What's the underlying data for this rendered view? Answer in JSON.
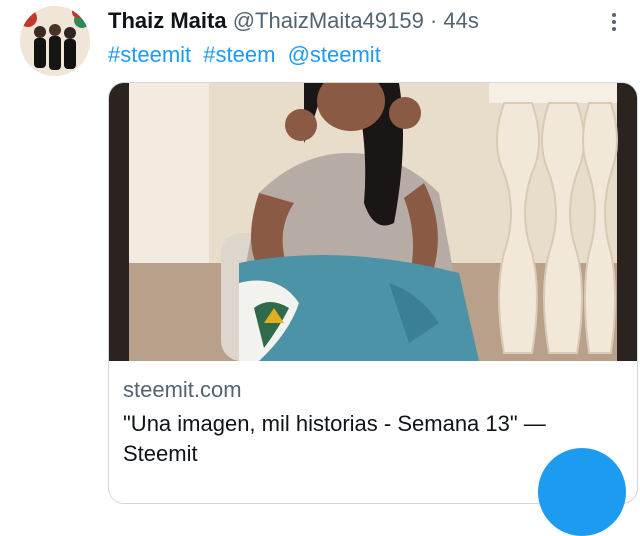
{
  "tweet": {
    "name": "Thaiz Maita",
    "handle": "@ThaizMaita49159",
    "separator": "·",
    "time": "44s",
    "hashtags": [
      "#steemit",
      "#steem",
      "@steemit"
    ]
  },
  "card": {
    "domain": "steemit.com",
    "title": "\"Una imagen, mil historias - Semana 13\" — Steemit"
  },
  "icons": {
    "more": "more-options-icon",
    "compose": "compose-fab-icon"
  },
  "colors": {
    "accent": "#1d9bf0",
    "text": "#0f1419",
    "muted": "#536471",
    "border": "#cfd9de"
  }
}
